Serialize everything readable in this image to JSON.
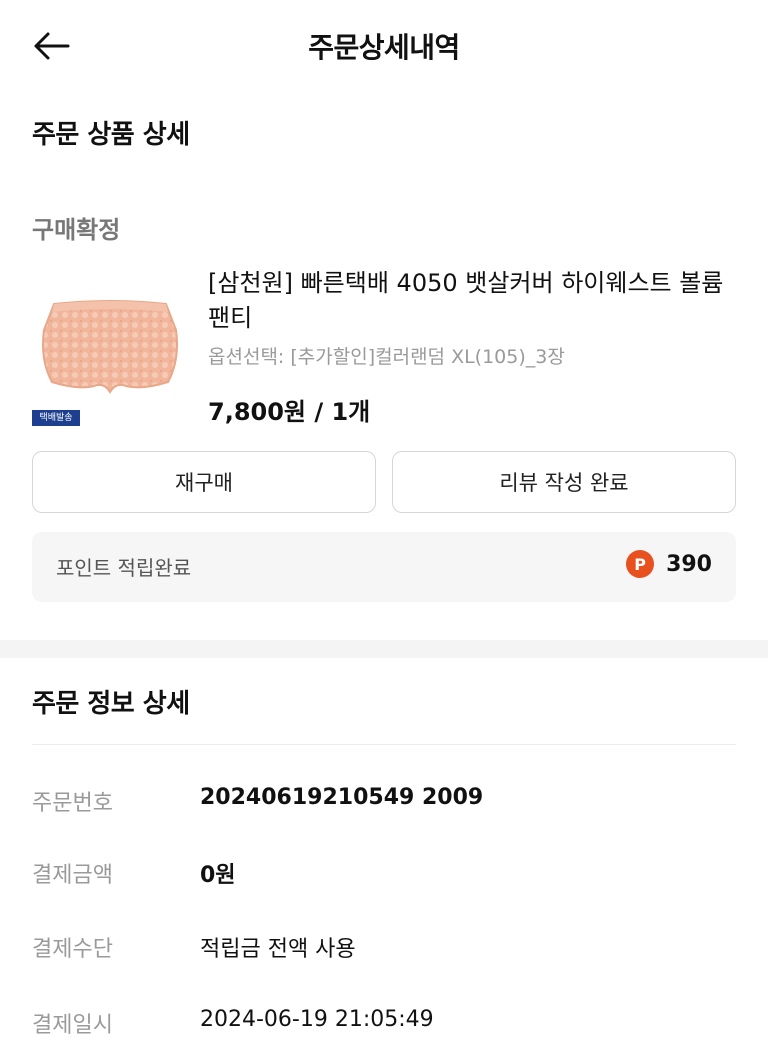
{
  "header": {
    "title": "주문상세내역"
  },
  "product_section": {
    "title": "주문 상품 상세",
    "status": "구매확정",
    "product": {
      "name": "[삼천원] 빠른택배 4050 뱃살커버 하이웨스트 볼륨팬티",
      "option": "옵션선택: [추가할인]컬러랜덤 XL(105)_3장",
      "price": "7,800원 / 1개",
      "badge": "택배발송"
    },
    "buttons": {
      "rebuy": "재구매",
      "review": "리뷰 작성 완료"
    },
    "points": {
      "label": "포인트 적립완료",
      "icon_letter": "P",
      "value": "390"
    }
  },
  "order_info": {
    "title": "주문 정보 상세",
    "rows": [
      {
        "label": "주문번호",
        "value": "20240619210549 2009"
      },
      {
        "label": "결제금액",
        "value": "0원"
      },
      {
        "label": "결제수단",
        "value": "적립금 전액 사용"
      },
      {
        "label": "결제일시",
        "value": "2024-06-19 21:05:49"
      }
    ]
  },
  "colors": {
    "accent_point": "#e8501e",
    "badge_blue": "#1e3f8f"
  }
}
